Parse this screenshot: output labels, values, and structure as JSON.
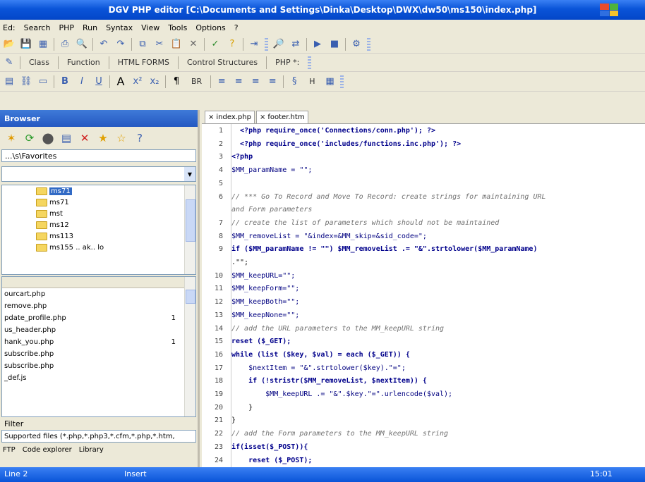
{
  "window": {
    "title": "DGV PHP editor [C:\\Documents and Settings\\Dinka\\Desktop\\DWX\\dw50\\ms150\\index.php]"
  },
  "menu": [
    "Ed:",
    "Search",
    "PHP",
    "Run",
    "Syntax",
    "View",
    "Tools",
    "Options",
    "?"
  ],
  "toolbar3": {
    "class_label": "Class",
    "function_label": "Function",
    "html_label": "HTML FORMS",
    "control_label": "Control Structures",
    "dollar_label": "PHP *:"
  },
  "toolbar4": {
    "size_a": "A",
    "h_label": "H",
    "br_label": "BR",
    "para": "¶"
  },
  "browser": {
    "title": "Browser",
    "path": "...\\s\\Favorites",
    "tree": [
      {
        "label": "ms71",
        "selected": true
      },
      {
        "label": "ms71",
        "selected": false
      },
      {
        "label": "mst",
        "selected": false
      },
      {
        "label": "ms12",
        "selected": false
      },
      {
        "label": "ms113",
        "selected": false
      },
      {
        "label": "ms155 .. ak.. lo",
        "selected": false
      }
    ],
    "files": [
      {
        "name": "ourcart.php",
        "size": ""
      },
      {
        "name": "remove.php",
        "size": ""
      },
      {
        "name": "pdate_profile.php",
        "size": "1"
      },
      {
        "name": "us_header.php",
        "size": ""
      },
      {
        "name": "hank_you.php",
        "size": "1"
      },
      {
        "name": "subscribe.php",
        "size": ""
      },
      {
        "name": "subscribe.php",
        "size": ""
      },
      {
        "name": "_def.js",
        "size": ""
      },
      {
        "name": "",
        "size": ""
      }
    ],
    "filter_label": "Filter",
    "filter_value": "Supported files (*.php,*.php3,*.cfm,*.php,*.htm,",
    "bottom_tabs": [
      "FTP",
      "Code explorer",
      "Library"
    ]
  },
  "editor": {
    "tabs": [
      {
        "label": "index.php"
      },
      {
        "label": "footer.htm"
      }
    ],
    "lines": [
      {
        "n": "1",
        "text": "  <?php require_once('Connections/conn.php'); ?>"
      },
      {
        "n": "2",
        "text": "  <?php require_once('includes/functions.inc.php'); ?>"
      },
      {
        "n": "3",
        "text": "<?php"
      },
      {
        "n": "4",
        "text": "$MM_paramName = \"\";"
      },
      {
        "n": "5",
        "text": ""
      },
      {
        "n": "6",
        "text": "// *** Go To Record and Move To Record: create strings for maintaining URL"
      },
      {
        "n": "",
        "text": "and Form parameters"
      },
      {
        "n": "7",
        "text": "// create the list of parameters which should not be maintained"
      },
      {
        "n": "8",
        "text": "$MM_removeList = \"&index=&MM_skip=&sid_code=\";"
      },
      {
        "n": "9",
        "text": "if ($MM_paramName != \"\") $MM_removeList .= \"&\".strtolower($MM_paramName)"
      },
      {
        "n": "",
        "text": ".\"\";"
      },
      {
        "n": "10",
        "text": "$MM_keepURL=\"\";"
      },
      {
        "n": "11",
        "text": "$MM_keepForm=\"\";"
      },
      {
        "n": "12",
        "text": "$MM_keepBoth=\"\";"
      },
      {
        "n": "13",
        "text": "$MM_keepNone=\"\";"
      },
      {
        "n": "14",
        "text": "// add the URL parameters to the MM_keepURL string"
      },
      {
        "n": "15",
        "text": "reset ($_GET);"
      },
      {
        "n": "16",
        "text": "while (list ($key, $val) = each ($_GET)) {"
      },
      {
        "n": "17",
        "text": "    $nextItem = \"&\".strtolower($key).\"=\";"
      },
      {
        "n": "18",
        "text": "    if (!stristr($MM_removeList, $nextItem)) {"
      },
      {
        "n": "19",
        "text": "        $MM_keepURL .= \"&\".$key.\"=\".urlencode($val);"
      },
      {
        "n": "20",
        "text": "    }"
      },
      {
        "n": "21",
        "text": "}"
      },
      {
        "n": "22",
        "text": "// add the Form parameters to the MM_keepURL string"
      },
      {
        "n": "23",
        "text": "if(isset($_POST)){"
      },
      {
        "n": "24",
        "text": "    reset ($_POST);"
      }
    ]
  },
  "status": {
    "line": "Line 2",
    "mode": "Insert",
    "time": "15:01"
  },
  "colors": {
    "title_bar": "#0a54d8",
    "face": "#ece9d8",
    "keyword": "#00008b",
    "comment": "#707070"
  }
}
